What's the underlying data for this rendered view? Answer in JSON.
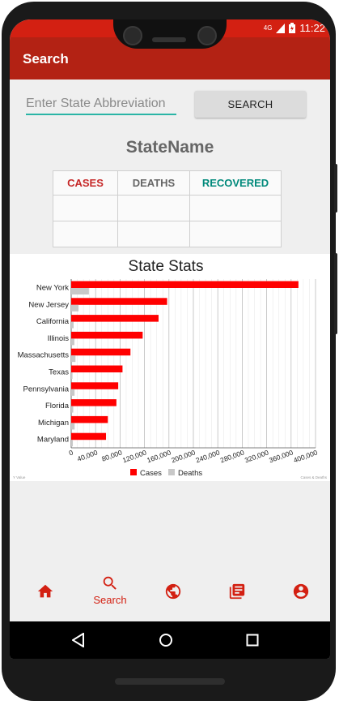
{
  "status_bar": {
    "network": "4G",
    "time": "11:22"
  },
  "app_bar": {
    "title": "Search"
  },
  "search": {
    "placeholder": "Enter State Abbreviation",
    "value": "",
    "button_label": "SEARCH"
  },
  "state_name": "StateName",
  "stats_table": {
    "headers": [
      "CASES",
      "DEATHS",
      "RECOVERED"
    ],
    "header_colors": [
      "#c62828",
      "#666666",
      "#00897b"
    ],
    "rows": [
      [
        "",
        "",
        ""
      ],
      [
        "",
        "",
        ""
      ]
    ]
  },
  "chart_data": {
    "type": "bar",
    "orientation": "horizontal",
    "title": "State Stats",
    "categories": [
      "New York",
      "New Jersey",
      "California",
      "Illinois",
      "Massachusetts",
      "Texas",
      "Pennsylvania",
      "Florida",
      "Michigan",
      "Maryland"
    ],
    "series": [
      {
        "name": "Cases",
        "color": "#ff0000",
        "values": [
          372000,
          157000,
          143000,
          117000,
          97000,
          84000,
          77000,
          74000,
          60000,
          57000
        ]
      },
      {
        "name": "Deaths",
        "color": "#c8c8c8",
        "values": [
          29000,
          12000,
          4000,
          5200,
          7000,
          2100,
          5500,
          3300,
          5600,
          2700
        ]
      }
    ],
    "x_ticks": [
      "0",
      "40,000",
      "80,000",
      "120,000",
      "160,000",
      "200,000",
      "240,000",
      "280,000",
      "320,000",
      "360,000",
      "400,000"
    ],
    "xlim": [
      0,
      400000
    ],
    "grid": true,
    "legend_position": "bottom",
    "corner_left_text": "Y Value",
    "corner_right_text": "Cases & Deaths"
  },
  "bottom_nav": {
    "active_color": "#d32012",
    "items": [
      {
        "icon": "home-icon",
        "label": ""
      },
      {
        "icon": "search-icon",
        "label": "Search"
      },
      {
        "icon": "globe-icon",
        "label": ""
      },
      {
        "icon": "news-icon",
        "label": ""
      },
      {
        "icon": "account-icon",
        "label": ""
      }
    ]
  }
}
